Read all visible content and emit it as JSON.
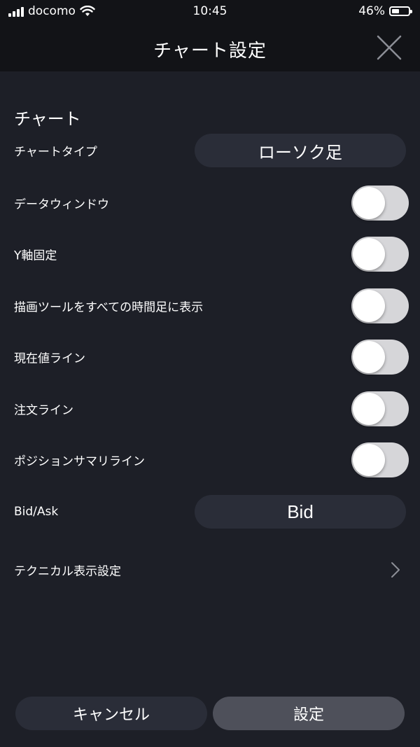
{
  "status": {
    "carrier": "docomo",
    "time": "10:45",
    "battery_percent": "46%",
    "battery_level": 0.46
  },
  "nav": {
    "title": "チャート設定"
  },
  "section": {
    "title": "チャート"
  },
  "settings": {
    "chart_type": {
      "label": "チャートタイプ",
      "value": "ローソク足"
    },
    "toggles": [
      {
        "label": "データウィンドウ",
        "on": false
      },
      {
        "label": "Y軸固定",
        "on": false
      },
      {
        "label": "描画ツールをすべての時間足に表示",
        "on": false
      },
      {
        "label": "現在値ライン",
        "on": false
      },
      {
        "label": "注文ライン",
        "on": false
      },
      {
        "label": "ポジションサマリライン",
        "on": false
      }
    ],
    "bid_ask": {
      "label": "Bid/Ask",
      "value": "Bid"
    },
    "technical": {
      "label": "テクニカル表示設定"
    }
  },
  "buttons": {
    "cancel": "キャンセル",
    "apply": "設定"
  },
  "colors": {
    "background": "#1d1f27",
    "header": "#121317",
    "pill": "#2a2d38",
    "apply_button": "#4e505a",
    "toggle_off": "#d6d6d9"
  }
}
